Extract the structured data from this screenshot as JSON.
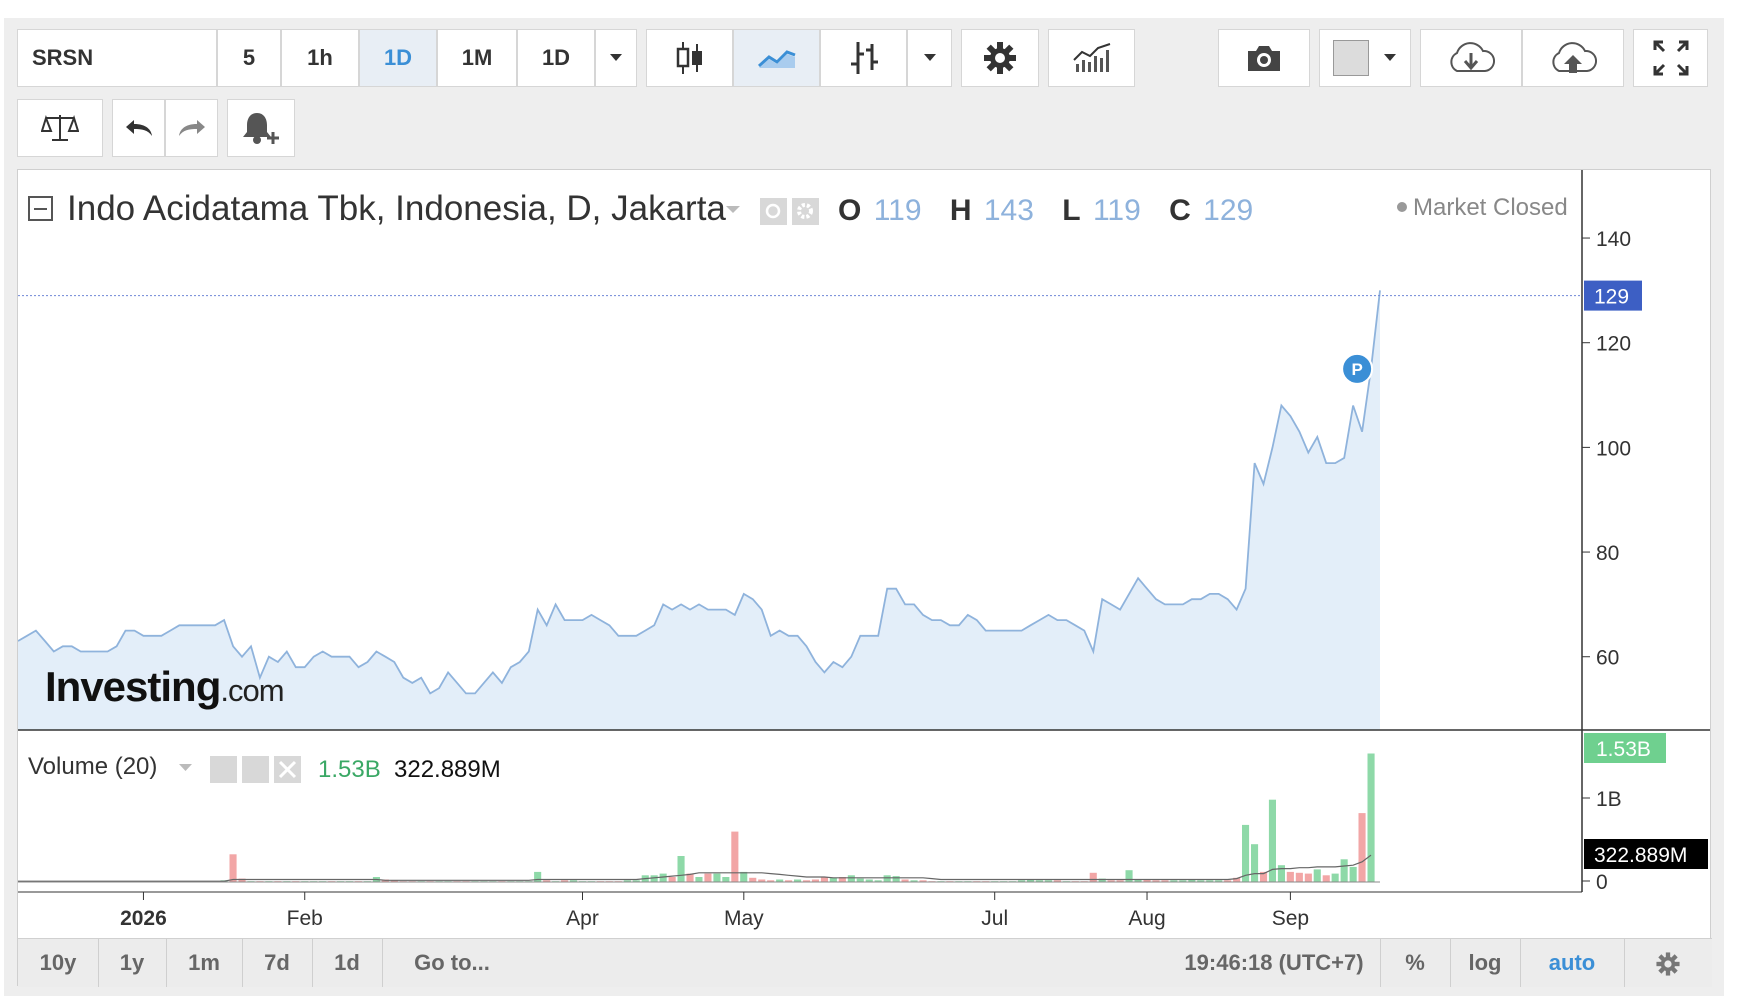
{
  "toolbar": {
    "symbol": "SRSN",
    "intervals": [
      "5",
      "1h",
      "1D",
      "1M",
      "1D"
    ],
    "active_interval": "1D"
  },
  "legend": {
    "title": "Indo Acidatama Tbk, Indonesia, D, Jakarta",
    "open_label": "O",
    "open": "119",
    "high_label": "H",
    "high": "143",
    "low_label": "L",
    "low": "119",
    "close_label": "C",
    "close": "129",
    "market_status": "Market Closed"
  },
  "volume_legend": {
    "title": "Volume (20)",
    "volume": "1.53B",
    "ma": "322.889M"
  },
  "price_axis": {
    "ticks": [
      "140",
      "120",
      "100",
      "80",
      "60"
    ],
    "last_price_label": "129"
  },
  "volume_axis": {
    "ticks": [
      "1B",
      "0"
    ],
    "volume_badge": "1.53B",
    "ma_badge": "322.889M"
  },
  "time_axis": {
    "labels": [
      "2026",
      "Feb",
      "Apr",
      "May",
      "Jul",
      "Aug",
      "Sep"
    ]
  },
  "marker": {
    "label": "P"
  },
  "watermark": {
    "brand": "Investing",
    "suffix": ".com"
  },
  "bottom_bar": {
    "ranges": [
      "10y",
      "1y",
      "1m",
      "7d",
      "1d"
    ],
    "goto": "Go to...",
    "clock": "19:46:18 (UTC+7)",
    "percent": "%",
    "log": "log",
    "auto": "auto"
  },
  "colors": {
    "line": "#8fb3dc",
    "area": "#e3eef9",
    "accent": "#3b8fd6",
    "badge": "#3d5fc4",
    "vol_up": "#8ed9a8",
    "vol_down": "#f2a6a6",
    "vol_badge": "#6fd08f"
  },
  "chart_data": {
    "type": "area",
    "title": "Indo Acidatama Tbk, Indonesia, D, Jakarta",
    "ylim": [
      46,
      153
    ],
    "series": [
      {
        "values": [
          63,
          64,
          65,
          63,
          61,
          62,
          62,
          61,
          61,
          61,
          61,
          62,
          65,
          65,
          64,
          64,
          64,
          65,
          66,
          66,
          66,
          66,
          66,
          67,
          62,
          60,
          62,
          56,
          60,
          59,
          61,
          58,
          58,
          60,
          61,
          60,
          60,
          60,
          58,
          59,
          61,
          60,
          59,
          56,
          55,
          56,
          53,
          54,
          57,
          55,
          53,
          53,
          55,
          57,
          55,
          58,
          59,
          61,
          69,
          66,
          70,
          67,
          67,
          67,
          68,
          67,
          66,
          64,
          64,
          64,
          65,
          66,
          70,
          69,
          70,
          69,
          70,
          69,
          69,
          69,
          68,
          72,
          71,
          69,
          64,
          65,
          64,
          64,
          62,
          59,
          57,
          59,
          58,
          60,
          64,
          64,
          64,
          73,
          73,
          70,
          70,
          68,
          67,
          67,
          66,
          66,
          68,
          67,
          65,
          65,
          65,
          65,
          65,
          66,
          67,
          68,
          67,
          67,
          66,
          65,
          61,
          71,
          70,
          69,
          72,
          75,
          73,
          71,
          70,
          70,
          70,
          71,
          71,
          72,
          72,
          71,
          69,
          73,
          97,
          93,
          100,
          108,
          106,
          103,
          99,
          102,
          97,
          97,
          98,
          108,
          103,
          115,
          130
        ]
      },
      {
        "name": "Volume (20)",
        "values": [
          0.01,
          0.01,
          0.01,
          0.01,
          0.01,
          0.01,
          0.01,
          0.01,
          0.01,
          0.01,
          0.01,
          0.01,
          0.01,
          0.01,
          0.01,
          0.01,
          0.01,
          0.01,
          0.01,
          0.01,
          0.01,
          0.01,
          0.01,
          0.02,
          0.33,
          0.04,
          0.01,
          0.01,
          0.01,
          0.01,
          0.01,
          0.01,
          0.01,
          0.01,
          0.01,
          0.01,
          0.01,
          0.01,
          0.01,
          0.01,
          0.06,
          0.03,
          0.02,
          0.01,
          0.01,
          0.01,
          0.01,
          0.01,
          0.01,
          0.01,
          0.01,
          0.01,
          0.01,
          0.01,
          0.01,
          0.01,
          0.01,
          0.01,
          0.12,
          0.02,
          0.01,
          0.02,
          0.02,
          0.01,
          0.01,
          0.01,
          0.01,
          0.01,
          0.02,
          0.02,
          0.08,
          0.08,
          0.1,
          0.06,
          0.31,
          0.1,
          0.06,
          0.1,
          0.1,
          0.06,
          0.6,
          0.12,
          0.05,
          0.03,
          0.02,
          0.03,
          0.02,
          0.03,
          0.02,
          0.03,
          0.06,
          0.05,
          0.06,
          0.08,
          0.04,
          0.03,
          0.02,
          0.08,
          0.07,
          0.03,
          0.02,
          0.02,
          0.01,
          0.01,
          0.01,
          0.01,
          0.01,
          0.01,
          0.01,
          0.01,
          0.01,
          0.01,
          0.02,
          0.03,
          0.02,
          0.02,
          0.02,
          0.01,
          0.01,
          0.01,
          0.11,
          0.04,
          0.02,
          0.02,
          0.14,
          0.03,
          0.03,
          0.02,
          0.02,
          0.02,
          0.02,
          0.03,
          0.02,
          0.02,
          0.02,
          0.02,
          0.05,
          0.68,
          0.45,
          0.12,
          0.98,
          0.2,
          0.12,
          0.11,
          0.1,
          0.15,
          0.08,
          0.1,
          0.27,
          0.18,
          0.82,
          1.53
        ]
      },
      {
        "name": "MA 20",
        "values": [
          0.01,
          0.01,
          0.01,
          0.01,
          0.01,
          0.01,
          0.01,
          0.01,
          0.01,
          0.01,
          0.01,
          0.01,
          0.01,
          0.01,
          0.01,
          0.01,
          0.01,
          0.01,
          0.01,
          0.01,
          0.01,
          0.01,
          0.01,
          0.01,
          0.03,
          0.03,
          0.03,
          0.03,
          0.03,
          0.03,
          0.03,
          0.03,
          0.03,
          0.03,
          0.03,
          0.03,
          0.03,
          0.03,
          0.03,
          0.03,
          0.03,
          0.02,
          0.02,
          0.02,
          0.02,
          0.02,
          0.02,
          0.02,
          0.02,
          0.02,
          0.02,
          0.02,
          0.02,
          0.02,
          0.02,
          0.02,
          0.02,
          0.02,
          0.03,
          0.03,
          0.03,
          0.03,
          0.03,
          0.03,
          0.03,
          0.03,
          0.03,
          0.03,
          0.03,
          0.03,
          0.04,
          0.05,
          0.06,
          0.07,
          0.08,
          0.09,
          0.11,
          0.11,
          0.11,
          0.11,
          0.11,
          0.11,
          0.11,
          0.11,
          0.1,
          0.09,
          0.08,
          0.07,
          0.06,
          0.06,
          0.06,
          0.05,
          0.05,
          0.05,
          0.05,
          0.05,
          0.05,
          0.05,
          0.05,
          0.05,
          0.05,
          0.05,
          0.04,
          0.03,
          0.03,
          0.03,
          0.03,
          0.03,
          0.03,
          0.03,
          0.03,
          0.03,
          0.03,
          0.03,
          0.03,
          0.03,
          0.03,
          0.03,
          0.03,
          0.03,
          0.03,
          0.03,
          0.03,
          0.03,
          0.03,
          0.03,
          0.03,
          0.03,
          0.03,
          0.03,
          0.03,
          0.03,
          0.03,
          0.03,
          0.03,
          0.03,
          0.04,
          0.08,
          0.1,
          0.1,
          0.15,
          0.16,
          0.16,
          0.17,
          0.17,
          0.18,
          0.18,
          0.18,
          0.19,
          0.2,
          0.24,
          0.32
        ]
      }
    ],
    "axis_ticks": {
      "price": [
        140,
        120,
        100,
        80,
        60
      ],
      "volume": [
        "1B",
        "0"
      ],
      "time": [
        "2026",
        "Feb",
        "Apr",
        "May",
        "Jul",
        "Aug",
        "Sep"
      ]
    },
    "last_price": 129,
    "grid": false,
    "legend": "top-left"
  }
}
